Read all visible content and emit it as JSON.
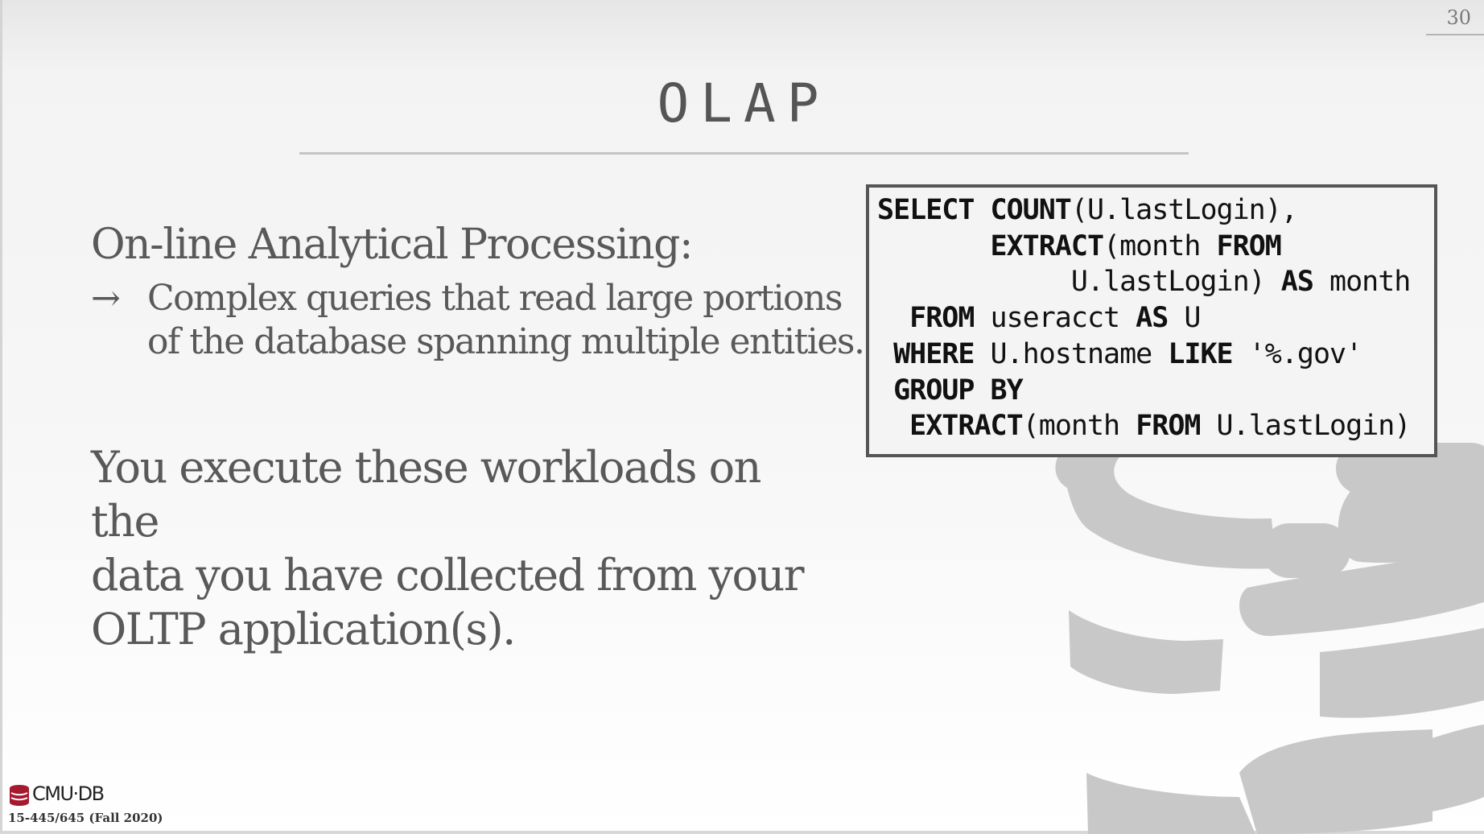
{
  "slide": {
    "page_number": "30",
    "title": "OLAP",
    "heading": "On-line Analytical Processing:",
    "bullet_arrow": "→",
    "sub_bullet_lines": [
      "Complex queries that read large portions",
      "of the database spanning multiple entities."
    ],
    "paragraph_lines": [
      "You execute these workloads on the",
      "data you have collected from your",
      "OLTP application(s)."
    ]
  },
  "sql": {
    "lines": [
      [
        {
          "t": "SELECT ",
          "kw": true
        },
        {
          "t": "COUNT",
          "kw": true
        },
        {
          "t": "(U.lastLogin),",
          "kw": false
        }
      ],
      [
        {
          "t": "       ",
          "kw": false
        },
        {
          "t": "EXTRACT",
          "kw": true
        },
        {
          "t": "(month ",
          "kw": false
        },
        {
          "t": "FROM",
          "kw": true
        }
      ],
      [
        {
          "t": "            U.lastLogin) ",
          "kw": false
        },
        {
          "t": "AS",
          "kw": true
        },
        {
          "t": " month",
          "kw": false
        }
      ],
      [
        {
          "t": "  ",
          "kw": false
        },
        {
          "t": "FROM",
          "kw": true
        },
        {
          "t": " useracct ",
          "kw": false
        },
        {
          "t": "AS",
          "kw": true
        },
        {
          "t": " U",
          "kw": false
        }
      ],
      [
        {
          "t": " ",
          "kw": false
        },
        {
          "t": "WHERE",
          "kw": true
        },
        {
          "t": " U.hostname ",
          "kw": false
        },
        {
          "t": "LIKE",
          "kw": true
        },
        {
          "t": " '%.gov'",
          "kw": false
        }
      ],
      [
        {
          "t": " ",
          "kw": false
        },
        {
          "t": "GROUP BY",
          "kw": true
        }
      ],
      [
        {
          "t": "  ",
          "kw": false
        },
        {
          "t": "EXTRACT",
          "kw": true
        },
        {
          "t": "(month ",
          "kw": false
        },
        {
          "t": "FROM",
          "kw": true
        },
        {
          "t": " U.lastLogin)",
          "kw": false
        }
      ]
    ]
  },
  "footer": {
    "logo_text": "CMU·DB",
    "course": "15-445/645 (Fall 2020)"
  },
  "colors": {
    "text": "#595959",
    "logo_gray": "#c8c8c8",
    "logo_red": "#a6192e"
  }
}
